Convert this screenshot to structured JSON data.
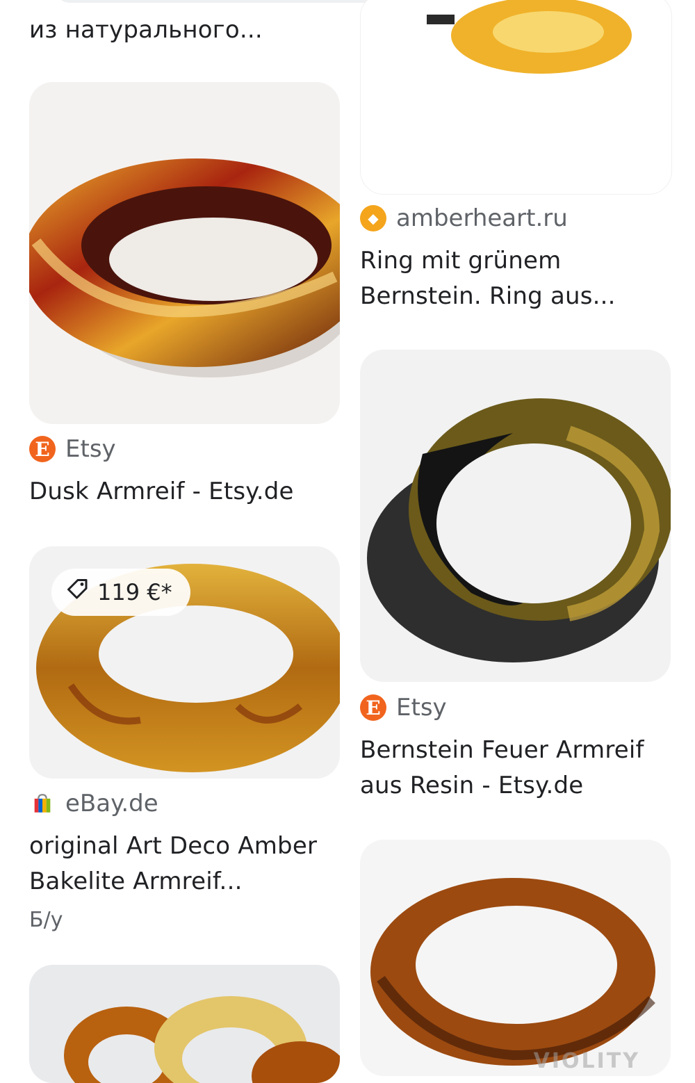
{
  "left_column": {
    "top_title": "из натурального...",
    "card1": {
      "source": "Etsy",
      "title": "Dusk Armreif - Etsy.de",
      "favicon": "etsy-icon",
      "image": "dusk-bangle-image"
    },
    "card2": {
      "price": "119 €*",
      "source": "eBay.de",
      "title_line1": "original Art Deco Amber",
      "title_line2": "Bakelite Armreif...",
      "condition": "Б/у",
      "favicon": "ebay-icon",
      "image": "amber-bakelite-bangle-image"
    },
    "card3": {
      "image": "amber-bangles-stack-image"
    }
  },
  "right_column": {
    "card1": {
      "source": "amberheart.ru",
      "title_line1": "Ring mit grünem",
      "title_line2": "Bernstein. Ring aus...",
      "favicon": "amberheart-icon",
      "image": "amber-ring-image"
    },
    "card2": {
      "source": "Etsy",
      "title_line1": "Bernstein Feuer Armreif",
      "title_line2": "aus Resin - Etsy.de",
      "favicon": "etsy-icon",
      "image": "resin-bangle-image"
    },
    "card3": {
      "image": "tortoise-bangle-image",
      "watermark": "VIOLITY"
    }
  },
  "colors": {
    "etsy": "#f1641e",
    "amber": "#f4a51c",
    "title": "#202124",
    "muted": "#5f6368"
  }
}
